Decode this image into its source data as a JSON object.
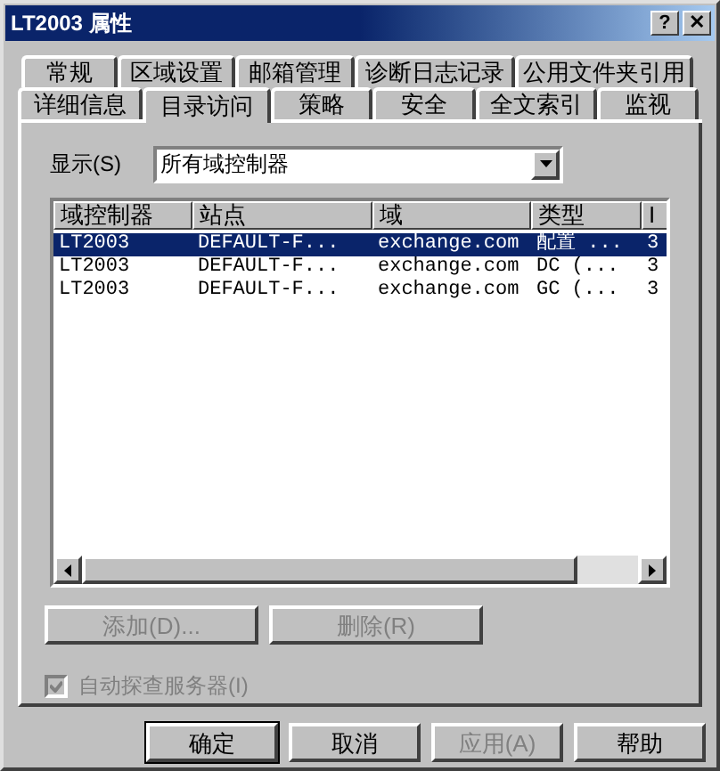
{
  "window": {
    "title": "LT2003 属性",
    "buttons": [
      {
        "label": "?"
      },
      {
        "label": "✕"
      }
    ]
  },
  "tab_rows": [
    [
      {
        "label": "常规",
        "selected": false
      },
      {
        "label": "区域设置",
        "selected": false
      },
      {
        "label": "邮箱管理",
        "selected": false
      },
      {
        "label": "诊断日志记录",
        "selected": false
      },
      {
        "label": "公用文件夹引用",
        "selected": false
      }
    ],
    [
      {
        "label": "详细信息",
        "selected": false
      },
      {
        "label": "目录访问",
        "selected": true
      },
      {
        "label": "策略",
        "selected": false
      },
      {
        "label": "安全",
        "selected": false
      },
      {
        "label": "全文索引",
        "selected": false
      },
      {
        "label": "监视",
        "selected": false
      }
    ]
  ],
  "show": {
    "label": "显示(S)",
    "value": "所有域控制器"
  },
  "table": {
    "columns": [
      "域控制器",
      "站点",
      "域",
      "类型",
      "I"
    ],
    "rows": [
      {
        "cells": [
          "LT2003",
          "DEFAULT-F...",
          "exchange.com",
          "配置 ...",
          "3"
        ],
        "selected": true
      },
      {
        "cells": [
          "LT2003",
          "DEFAULT-F...",
          "exchange.com",
          "DC (...",
          "3"
        ],
        "selected": false
      },
      {
        "cells": [
          "LT2003",
          "DEFAULT-F...",
          "exchange.com",
          "GC (...",
          "3"
        ],
        "selected": false
      }
    ]
  },
  "list_buttons": [
    {
      "label": "添加(D)...",
      "disabled": true
    },
    {
      "label": "删除(R)",
      "disabled": true
    }
  ],
  "auto_detect": {
    "label": "自动探查服务器(I)",
    "checked": true,
    "disabled": true
  },
  "dialog_buttons": [
    {
      "label": "确定",
      "disabled": false,
      "default": true
    },
    {
      "label": "取消",
      "disabled": false,
      "default": false
    },
    {
      "label": "应用(A)",
      "disabled": true,
      "default": false
    },
    {
      "label": "帮助",
      "disabled": false,
      "default": false
    }
  ]
}
